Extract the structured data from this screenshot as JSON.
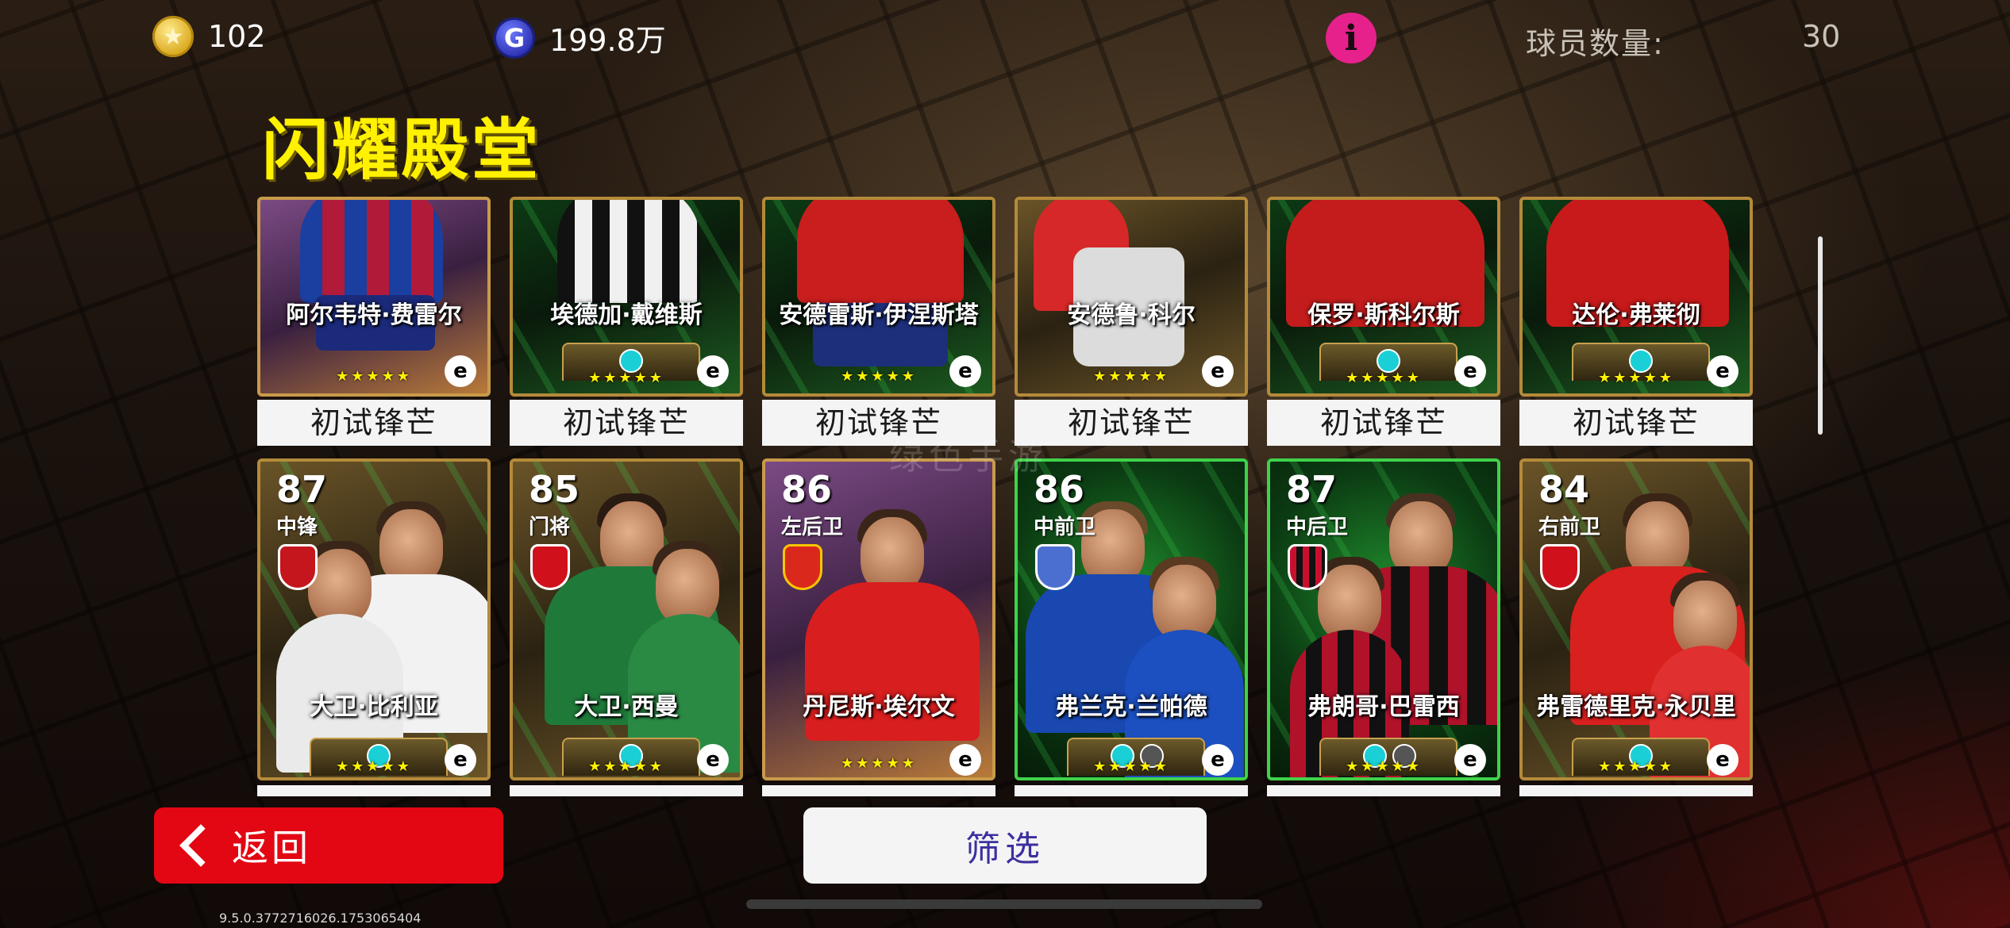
{
  "header": {
    "coins": "102",
    "gp": "199.8万",
    "gp_symbol": "G",
    "coin_symbol": "★",
    "info_symbol": "i",
    "player_count_label": "球员数量:",
    "player_count_value": "30"
  },
  "title": "闪耀殿堂",
  "watermark": "绿色手游",
  "row1": [
    {
      "name": "阿尔韦特·费雷尔",
      "label": "初试锋芒",
      "stars": "★★★★★"
    },
    {
      "name": "埃德加·戴维斯",
      "label": "初试锋芒",
      "stars": "★★★★★"
    },
    {
      "name": "安德雷斯·伊涅斯塔",
      "label": "初试锋芒",
      "stars": "★★★★★"
    },
    {
      "name": "安德鲁·科尔",
      "label": "初试锋芒",
      "stars": "★★★★★"
    },
    {
      "name": "保罗·斯科尔斯",
      "label": "初试锋芒",
      "stars": "★★★★★"
    },
    {
      "name": "达伦·弗莱彻",
      "label": "初试锋芒",
      "stars": "★★★★★"
    }
  ],
  "row2": [
    {
      "rating": "87",
      "position": "中锋",
      "name": "大卫·比利亚",
      "stars": "★★★★★"
    },
    {
      "rating": "85",
      "position": "门将",
      "name": "大卫·西曼",
      "stars": "★★★★★"
    },
    {
      "rating": "86",
      "position": "左后卫",
      "name": "丹尼斯·埃尔文",
      "stars": "★★★★★"
    },
    {
      "rating": "86",
      "position": "中前卫",
      "name": "弗兰克·兰帕德",
      "stars": "★★★★★"
    },
    {
      "rating": "87",
      "position": "中后卫",
      "name": "弗朗哥·巴雷西",
      "stars": "★★★★★"
    },
    {
      "rating": "84",
      "position": "右前卫",
      "name": "弗雷德里克·永贝里",
      "stars": "★★★★★"
    }
  ],
  "e_logo": "e",
  "buttons": {
    "back": "返回",
    "filter": "筛选"
  },
  "version": "9.5.0.3772716026.1753065404",
  "colors": {
    "title": "#fff100",
    "back": "#e30613",
    "filter_text": "#3b2fa0",
    "info": "#e6218c"
  }
}
